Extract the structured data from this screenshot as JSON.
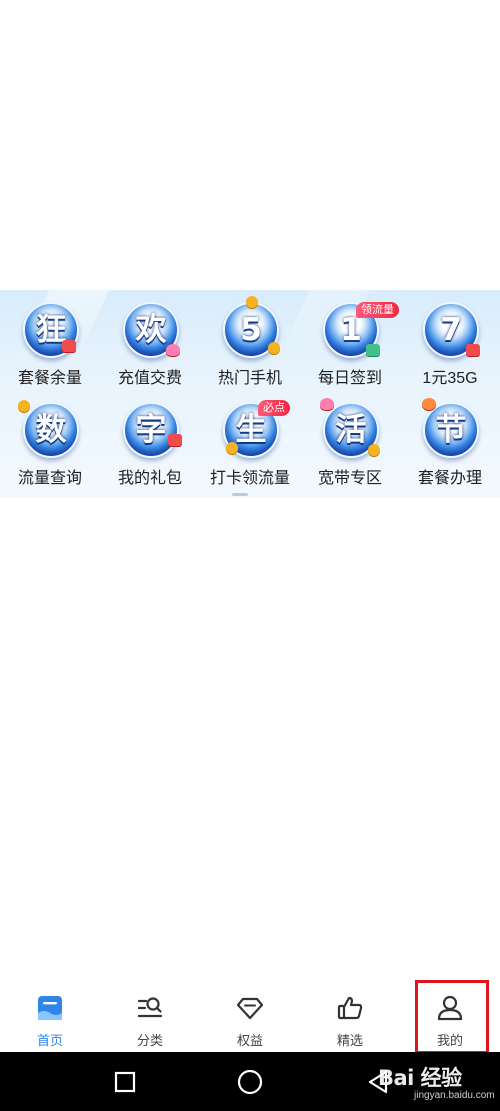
{
  "grid": {
    "items": [
      {
        "glyph": "狂",
        "label": "套餐余量",
        "tag": ""
      },
      {
        "glyph": "欢",
        "label": "充值交费",
        "tag": ""
      },
      {
        "glyph": "5",
        "label": "热门手机",
        "tag": ""
      },
      {
        "glyph": "1",
        "label": "每日签到",
        "tag": "领流量"
      },
      {
        "glyph": "7",
        "label": "1元35G",
        "tag": ""
      },
      {
        "glyph": "数",
        "label": "流量查询",
        "tag": ""
      },
      {
        "glyph": "字",
        "label": "我的礼包",
        "tag": ""
      },
      {
        "glyph": "生",
        "label": "打卡领流量",
        "tag": "必点"
      },
      {
        "glyph": "活",
        "label": "宽带专区",
        "tag": ""
      },
      {
        "glyph": "节",
        "label": "套餐办理",
        "tag": ""
      }
    ]
  },
  "tabbar": {
    "tabs": [
      {
        "label": "首页",
        "icon": "home-icon",
        "active": true
      },
      {
        "label": "分类",
        "icon": "category-search-icon",
        "active": false
      },
      {
        "label": "权益",
        "icon": "diamond-icon",
        "active": false
      },
      {
        "label": "精选",
        "icon": "thumbs-up-icon",
        "active": false
      },
      {
        "label": "我的",
        "icon": "user-icon",
        "active": false
      }
    ],
    "highlighted_tab": "我的"
  },
  "system_nav": {
    "buttons": [
      "recent-apps-icon",
      "home-circle-icon",
      "back-triangle-icon"
    ]
  },
  "watermark": {
    "main": "Bai 经验",
    "sub": "jingyan.baidu.com"
  },
  "colors": {
    "accent": "#2f86e8",
    "badge_blue": "#1e4fb8",
    "tag_red": "#f0283e",
    "highlight_red": "#e0141e"
  }
}
